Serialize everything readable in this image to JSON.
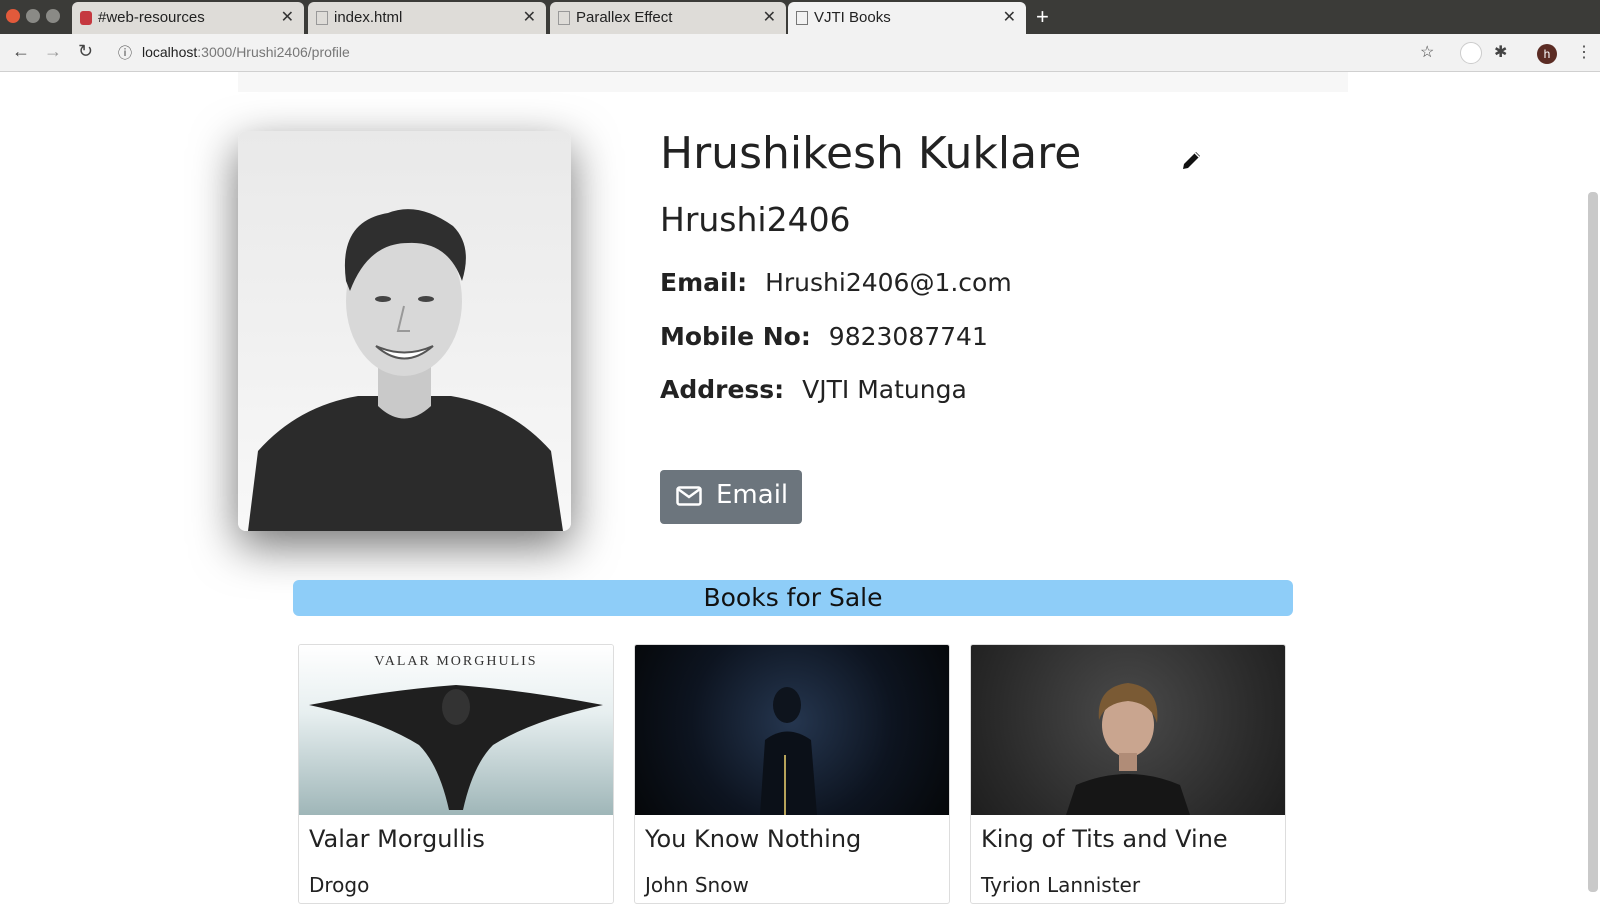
{
  "browser": {
    "tabs": [
      {
        "label": "#web-resources"
      },
      {
        "label": "index.html"
      },
      {
        "label": "Parallex Effect"
      },
      {
        "label": "VJTI Books"
      }
    ],
    "url_host": "localhost",
    "url_rest": ":3000/Hrushi2406/profile",
    "profile_initial": "h"
  },
  "profile": {
    "name": "Hrushikesh Kuklare",
    "username": "Hrushi2406",
    "email_label": "Email:",
    "email_value": "Hrushi2406@1.com",
    "mobile_label": "Mobile No:",
    "mobile_value": "9823087741",
    "address_label": "Address:",
    "address_value": "VJTI Matunga",
    "email_button_label": "Email"
  },
  "books_section": {
    "heading": "Books for Sale",
    "cards": [
      {
        "title": "Valar Morgullis",
        "owner": "Drogo",
        "image_text": "VALAR   MORGHULIS"
      },
      {
        "title": "You Know Nothing",
        "owner": "John Snow"
      },
      {
        "title": "King of Tits and Vine",
        "owner": "Tyrion Lannister"
      }
    ]
  },
  "colors": {
    "books_bar": "#8ecdf8",
    "email_button": "#6c757d"
  }
}
